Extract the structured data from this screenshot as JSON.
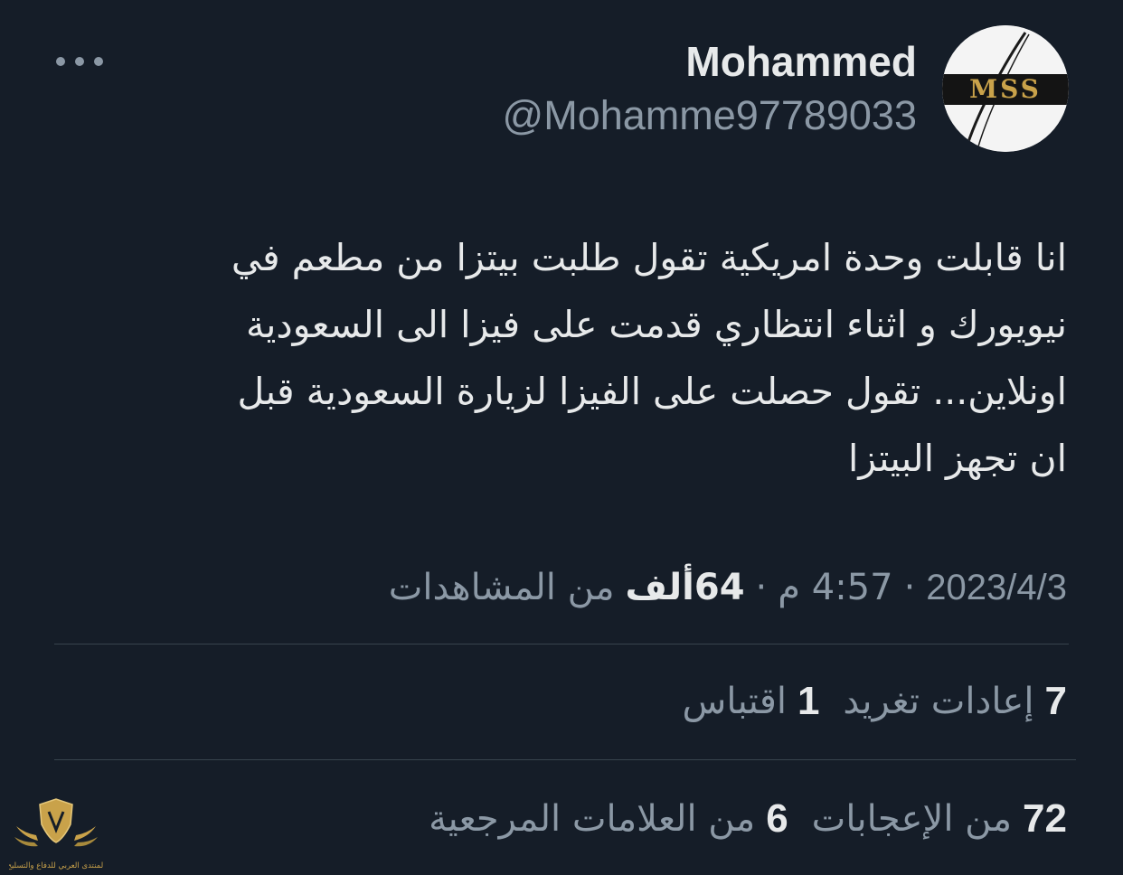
{
  "author": {
    "name": "Mohammed",
    "handle": "@Mohamme97789033",
    "avatar_text": "MSS"
  },
  "icons": {
    "more": "more-horizontal-icon"
  },
  "tweet": {
    "lines": [
      "انا قابلت وحدة امريكية تقول طلبت بيتزا من مطعم في",
      "نيويورك و اثناء انتظاري قدمت على فيزا الى السعودية",
      "اونلاين... تقول حصلت على الفيزا لزيارة السعودية قبل",
      "ان تجهز البيتزا"
    ]
  },
  "meta": {
    "date": "2023/4/3",
    "time": "4:57 م",
    "separator": "·",
    "views_count": "64ألف",
    "views_label": "من المشاهدات"
  },
  "stats": {
    "retweets": {
      "count": "7",
      "label": "إعادات تغريد"
    },
    "quotes": {
      "count": "1",
      "label": "اقتباس"
    },
    "likes": {
      "count": "72",
      "label": "من الإعجابات"
    },
    "bookmarks": {
      "count": "6",
      "label": "من العلامات المرجعية"
    }
  },
  "watermark": {
    "text": "المنتدى العربي للدفاع والتسليح"
  },
  "colors": {
    "background": "#151d28",
    "primary_text": "#e7e9ea",
    "secondary_text": "#8b98a5",
    "divider": "#38444d",
    "avatar_gold": "#c9a24a"
  }
}
